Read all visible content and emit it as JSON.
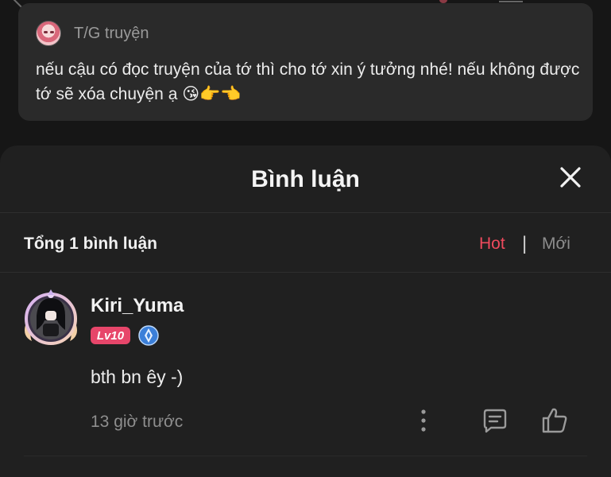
{
  "note": {
    "author_label": "T/G truyện",
    "text": "nếu cậu có đọc truyện của tớ thì cho tớ xin ý tưởng nhé! nếu không được tớ sẽ xóa chuyện ạ 😘👉👈"
  },
  "comments_sheet": {
    "title": "Bình luận",
    "total_label": "Tổng 1 bình luận",
    "sort_options": [
      "Hot",
      "Mới"
    ],
    "sort_active": "Hot",
    "items": [
      {
        "user": "Kiri_Yuma",
        "level": "Lv10",
        "text": "bth bn êy -)",
        "time": "13 giờ trước"
      }
    ]
  },
  "colors": {
    "accent": "#ef4a5d",
    "level_badge": "#e7466a",
    "sheet_bg": "#202020",
    "card_bg": "#2a2a2a"
  },
  "icons": {
    "close": "close-icon",
    "more": "more-vertical-icon",
    "reply": "comment-reply-icon",
    "like": "thumbs-up-icon",
    "rank": "rank-badge-icon"
  }
}
